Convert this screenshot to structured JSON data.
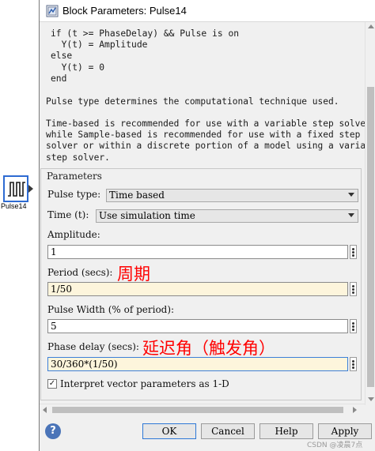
{
  "block": {
    "label": "Pulse14"
  },
  "window": {
    "title": "Block Parameters: Pulse14"
  },
  "description": {
    "code": "if (t >= PhaseDelay) && Pulse is on\n  Y(t) = Amplitude\nelse\n  Y(t) = 0\nend",
    "para1": "Pulse type determines the computational technique used.",
    "para2": "Time-based is recommended for use with a variable step solver,\nwhile Sample-based is recommended for use with a fixed step\nsolver or within a discrete portion of a model using a variable\nstep solver."
  },
  "params": {
    "title": "Parameters",
    "pulse_type": {
      "label": "Pulse type:",
      "value": "Time based"
    },
    "time": {
      "label": "Time (t):",
      "value": "Use simulation time"
    },
    "amplitude": {
      "label": "Amplitude:",
      "value": "1"
    },
    "period": {
      "label": "Period (secs):",
      "value": "1/50",
      "annotation": "周期"
    },
    "pulse_width": {
      "label": "Pulse Width (% of period):",
      "value": "5"
    },
    "phase_delay": {
      "label": "Phase delay (secs):",
      "value": "30/360*(1/50)",
      "annotation": "延迟角（触发角）"
    },
    "interpret": {
      "label": "Interpret vector parameters as 1-D",
      "checked": true,
      "check_glyph": "✓"
    }
  },
  "buttons": {
    "ok": "OK",
    "cancel": "Cancel",
    "help": "Help",
    "apply": "Apply",
    "help_icon": "?"
  },
  "watermark": "CSDN @凌晨7点",
  "icons": [
    "pulse-icon",
    "block-params-icon",
    "dropdown-arrow-icon",
    "more-options-icon",
    "help-icon"
  ],
  "colors": {
    "annotation": "#ff0000",
    "focus_border": "#3c7fd8",
    "field_highlight": "#fdf5dc"
  }
}
